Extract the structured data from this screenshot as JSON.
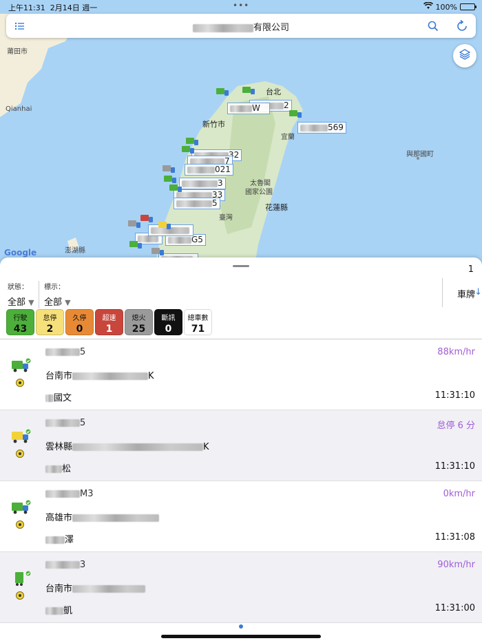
{
  "status_bar": {
    "time": "上午11:31",
    "date": "2月14日 週一",
    "battery": "100%"
  },
  "header": {
    "company_suffix": "有限公司"
  },
  "map": {
    "labels": [
      "莆田市",
      "Qianhai",
      "台北",
      "新竹市",
      "宜蘭",
      "太魯閣",
      "國家公園",
      "花蓮縣",
      "臺灣",
      "澎湖縣",
      "與那國町"
    ],
    "attribution": "Google",
    "tags": [
      "2",
      "W",
      "569",
      "32",
      "7",
      "021",
      "3",
      "33",
      "5",
      "G5"
    ]
  },
  "panel": {
    "page": "1",
    "status_filter": {
      "label": "狀態：",
      "value": "全部"
    },
    "display_filter": {
      "label": "標示：",
      "value": "全部"
    },
    "sort": {
      "label": "車牌",
      "arrow": "↓"
    }
  },
  "counters": [
    {
      "label": "行駛",
      "count": "43",
      "color": "#4caf3a"
    },
    {
      "label": "怠停",
      "count": "2",
      "color": "#f6e07a"
    },
    {
      "label": "久停",
      "count": "0",
      "color": "#e88a35"
    },
    {
      "label": "超速",
      "count": "1",
      "color": "#c8463b"
    },
    {
      "label": "熄火",
      "count": "25",
      "color": "#9a9a9a"
    },
    {
      "label": "斷訊",
      "count": "0",
      "color": "#111111"
    },
    {
      "label": "總車數",
      "count": "71",
      "color": "#ffffff"
    }
  ],
  "vehicles": [
    {
      "plate_suffix": "5",
      "speed": "88km/hr",
      "city": "台南市",
      "addr_suffix": "K",
      "driver_suffix": "國文",
      "time": "11:31:10"
    },
    {
      "plate_suffix": "5",
      "speed": "怠停 6 分",
      "city": "雲林縣",
      "addr_suffix": "K",
      "driver_suffix": "松",
      "time": "11:31:10"
    },
    {
      "plate_suffix": "M3",
      "speed": "0km/hr",
      "city": "高雄市",
      "addr_suffix": "",
      "driver_suffix": "澤",
      "time": "11:31:08"
    },
    {
      "plate_suffix": "3",
      "speed": "90km/hr",
      "city": "台南市",
      "addr_suffix": "",
      "driver_suffix": "凱",
      "time": "11:31:00"
    }
  ]
}
